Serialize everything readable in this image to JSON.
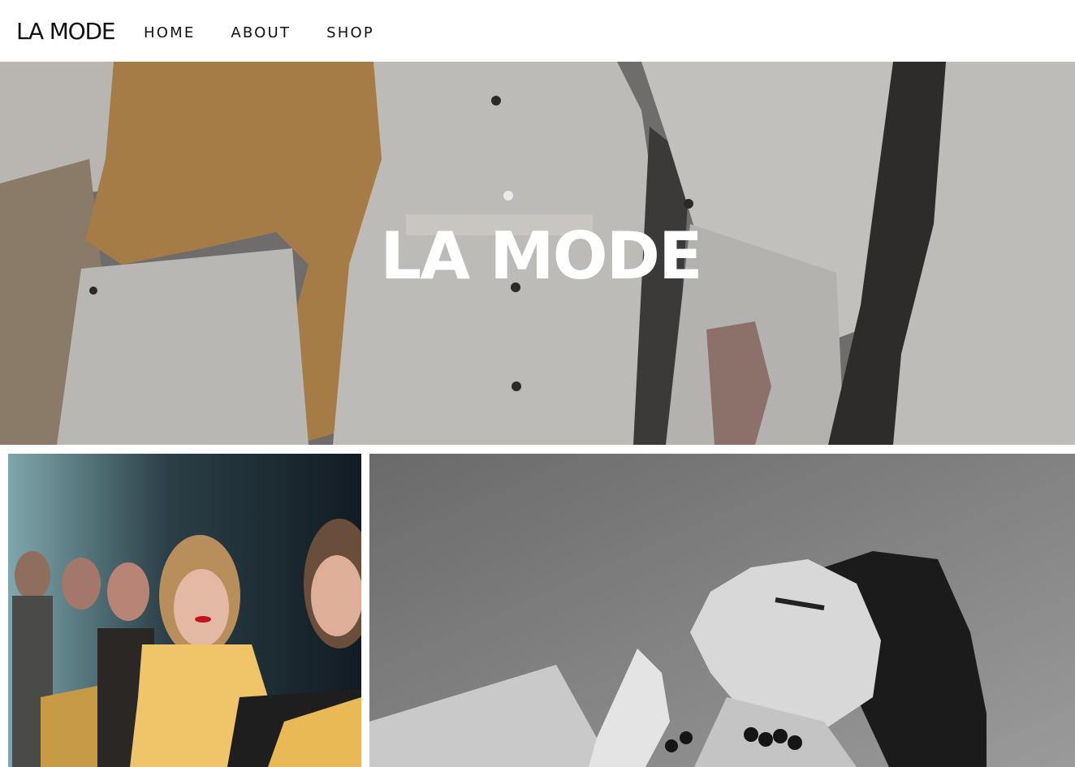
{
  "header": {
    "logo": "LA MODE",
    "nav": [
      {
        "label": "HOME"
      },
      {
        "label": "ABOUT"
      },
      {
        "label": "SHOP"
      }
    ]
  },
  "hero": {
    "title": "LA MODE"
  },
  "colors": {
    "background": "#ffffff",
    "text": "#111111",
    "hero_overlay": "#6e6c6a",
    "hero_title": "#ffffff"
  }
}
